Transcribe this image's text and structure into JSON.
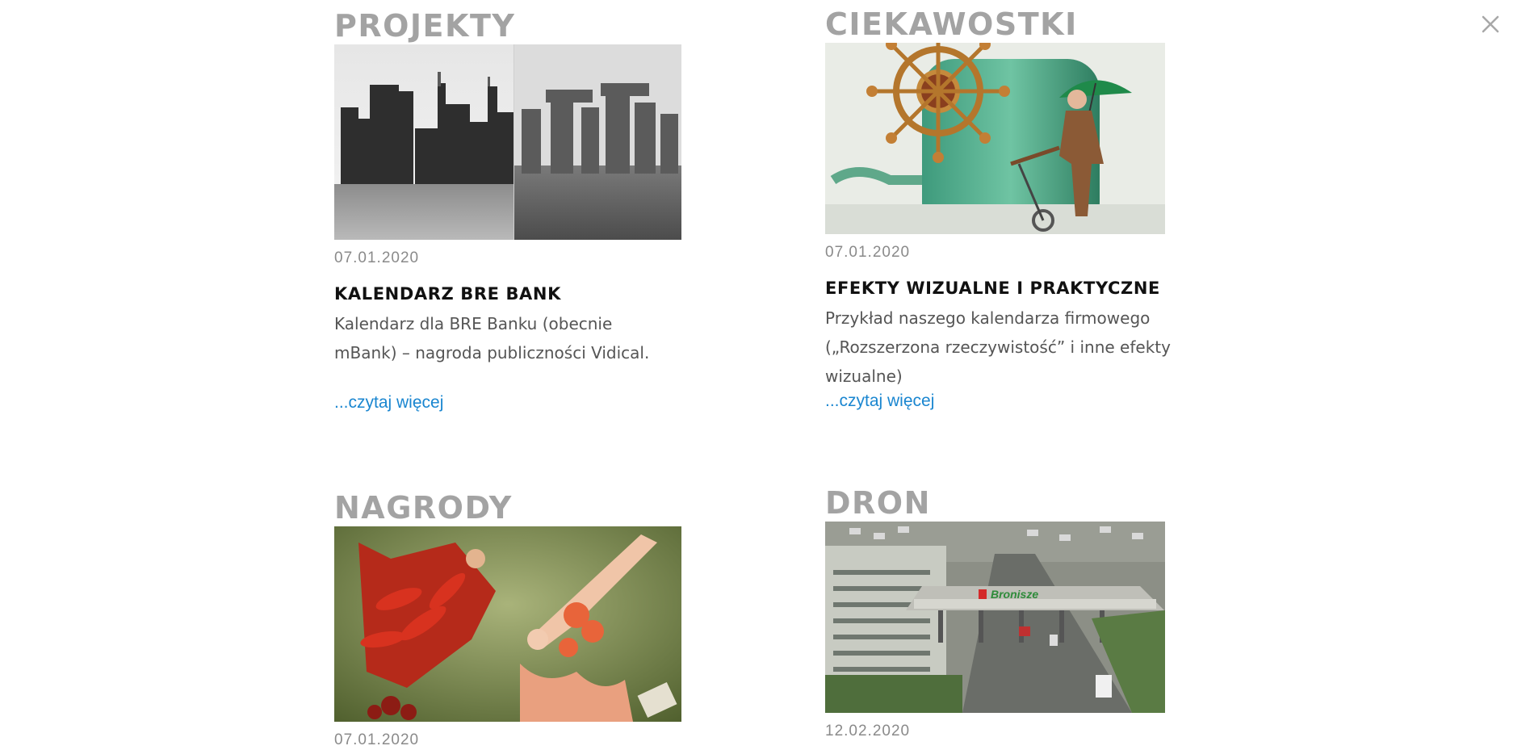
{
  "close": {
    "label": "×"
  },
  "sections": [
    {
      "title": "PROJEKTY",
      "date": "07.01.2020",
      "post_title": "KALENDARZ BRE BANK",
      "excerpt": "Kalendarz dla BRE Banku (obecnie mBank) – nagroda publiczności Vidical.",
      "read_more": "...czytaj więcej"
    },
    {
      "title": "CIEKAWOSTKI",
      "date": "07.01.2020",
      "post_title": "EFEKTY WIZUALNE I PRAKTYCZNE",
      "excerpt": "Przykład naszego kalendarza firmowego („Rozszerzona rzeczywistość” i inne efekty wizualne)",
      "read_more": "...czytaj więcej"
    },
    {
      "title": "NAGRODY",
      "date": "07.01.2020"
    },
    {
      "title": "DRON",
      "date": "12.02.2020",
      "image_text": "Bronisze"
    }
  ],
  "colors": {
    "heading_gray": "#a3a3a3",
    "link_blue": "#1a86d0",
    "brand_red": "#d42a2a",
    "brand_green": "#2e8b3a"
  }
}
